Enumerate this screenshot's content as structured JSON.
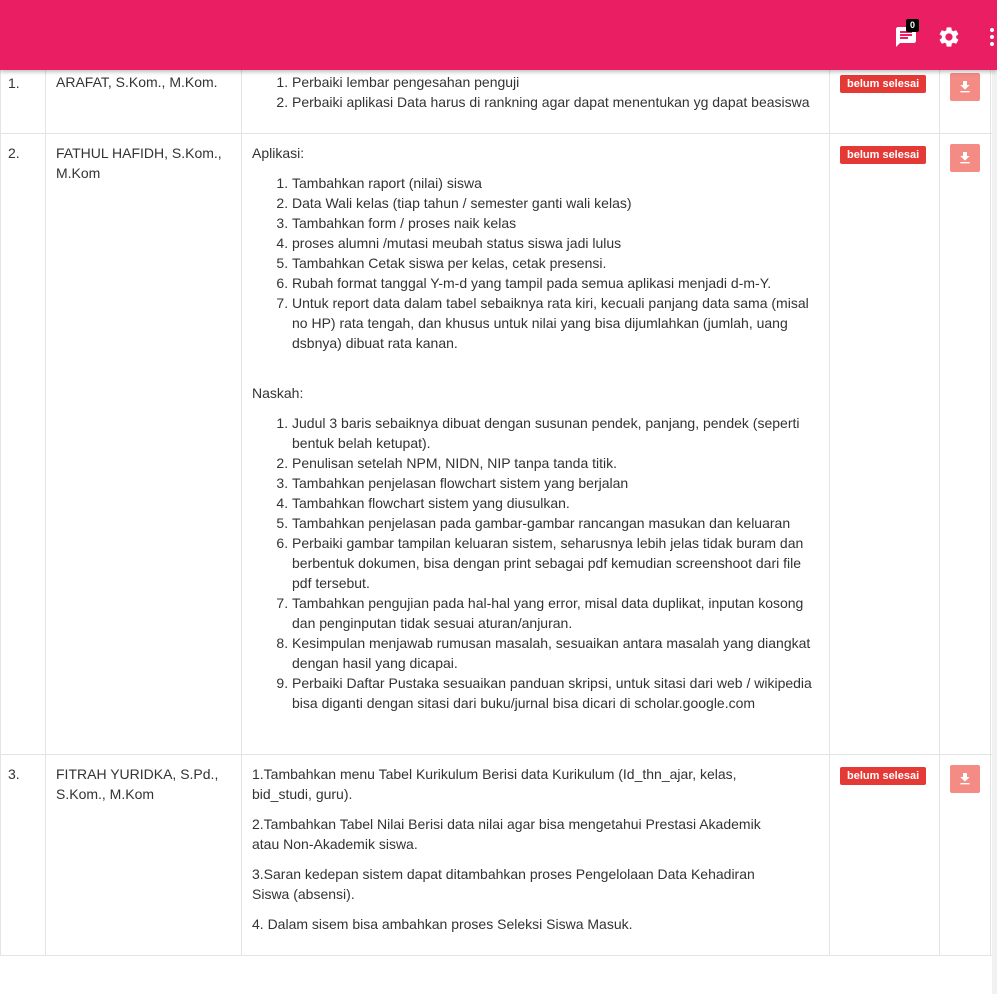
{
  "header": {
    "notification_count": "0",
    "icons": [
      "chat-icon",
      "gear-icon",
      "more-vert-icon"
    ],
    "background": "#e91e63"
  },
  "rows": [
    {
      "no": "1.",
      "name": "ARAFAT, S.Kom., M.Kom.",
      "notes": [
        "Perbaiki lembar pengesahan penguji",
        "Perbaiki aplikasi Data harus di rankning agar dapat menentukan yg dapat beasiswa"
      ],
      "status": "belum selesai"
    },
    {
      "no": "2.",
      "name": "FATHUL HAFIDH, S.Kom., M.Kom",
      "aplikasi_label": "Aplikasi:",
      "aplikasi": [
        "Tambahkan raport (nilai) siswa",
        "Data Wali kelas (tiap tahun / semester ganti wali kelas)",
        "Tambahkan form / proses naik kelas",
        "proses alumni /mutasi meubah status siswa jadi lulus",
        "Tambahkan Cetak siswa per kelas, cetak presensi.",
        "Rubah format tanggal Y-m-d yang tampil pada semua aplikasi menjadi d-m-Y.",
        "Untuk report data dalam tabel sebaiknya rata kiri, kecuali panjang data sama (misal no HP) rata tengah, dan khusus untuk nilai yang bisa dijumlahkan (jumlah, uang dsbnya) dibuat rata kanan."
      ],
      "naskah_label": "Naskah:",
      "naskah": [
        "Judul 3 baris sebaiknya dibuat dengan susunan pendek, panjang, pendek (seperti bentuk belah ketupat).",
        "Penulisan setelah NPM, NIDN, NIP tanpa tanda titik.",
        "Tambahkan penjelasan flowchart sistem yang berjalan",
        "Tambahkan flowchart sistem yang diusulkan.",
        "Tambahkan penjelasan pada gambar-gambar rancangan masukan dan keluaran",
        "Perbaiki gambar tampilan keluaran sistem, seharusnya lebih jelas tidak buram dan berbentuk dokumen, bisa dengan print sebagai pdf kemudian screenshoot dari file pdf tersebut.",
        "Tambahkan pengujian pada hal-hal yang error, misal data duplikat, inputan kosong dan penginputan tidak sesuai aturan/anjuran.",
        "Kesimpulan menjawab rumusan masalah,  sesuaikan antara masalah yang diangkat dengan hasil yang dicapai.",
        "Perbaiki Daftar Pustaka sesuaikan panduan skripsi, untuk sitasi dari web / wikipedia bisa diganti dengan sitasi dari buku/jurnal bisa dicari di scholar.google.com"
      ],
      "status": "belum selesai"
    },
    {
      "no": "3.",
      "name": "FITRAH YURIDKA, S.Pd., S.Kom., M.Kom",
      "paragraphs": [
        "1.Tambahkan menu Tabel Kurikulum Berisi data Kurikulum (Id_thn_ajar, kelas, bid_studi, guru).",
        "2.Tambahkan Tabel Nilai Berisi data nilai agar bisa mengetahui Prestasi Akademik atau Non-Akademik siswa.",
        "3.Saran kedepan sistem dapat ditambahkan proses Pengelolaan Data Kehadiran Siswa (absensi).",
        "4. Dalam sisem bisa ambahkan proses Seleksi Siswa Masuk."
      ],
      "status": "belum selesai"
    }
  ]
}
